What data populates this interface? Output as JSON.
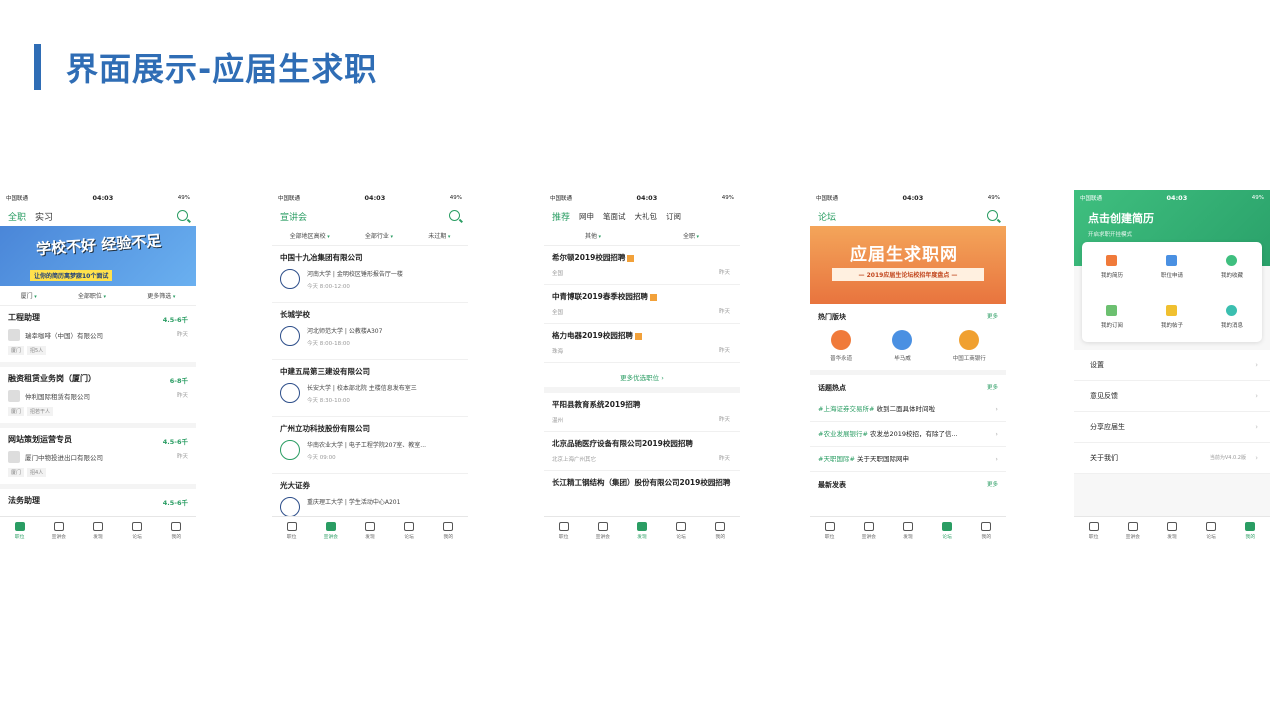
{
  "header": {
    "title": "界面展示-应届生求职"
  },
  "status": {
    "carrier": "中国联通",
    "time": "04:03",
    "battery": "49%"
  },
  "tabbar": [
    "职位",
    "宣讲会",
    "发现",
    "论坛",
    "我的"
  ],
  "p1": {
    "tabs": [
      "全职",
      "实习"
    ],
    "banner": {
      "title": "学校不好 经验不足",
      "sub": "让你的简历离梦寐10个面试"
    },
    "filters": [
      "厦门",
      "全部职位",
      "更多筛选"
    ],
    "jobs": [
      {
        "title": "工程助理",
        "salary": "4.5-6千",
        "company": "瑞幸咖啡（中国）有限公司",
        "date": "昨天",
        "tags": [
          "厦门",
          "招5人"
        ]
      },
      {
        "title": "融资租赁业务岗（厦门）",
        "salary": "6-8千",
        "company": "仲利国际租赁有限公司",
        "date": "昨天",
        "tags": [
          "厦门",
          "招若干人"
        ]
      },
      {
        "title": "网站策划运营专员",
        "salary": "4.5-6千",
        "company": "厦门中物投进出口有限公司",
        "date": "昨天",
        "tags": [
          "厦门",
          "招4人"
        ]
      },
      {
        "title": "法务助理",
        "salary": "4.5-6千",
        "company": "",
        "date": "",
        "tags": []
      }
    ]
  },
  "p2": {
    "title": "宣讲会",
    "filters": [
      "全部地区高校",
      "全部行业",
      "未过期"
    ],
    "items": [
      {
        "title": "中国十九冶集团有限公司",
        "addr": "河南大学 | 金明校区锤形报告厅一楼",
        "time": "今天 8:00-12:00"
      },
      {
        "title": "长城学校",
        "addr": "河北师范大学 | 公教楼A307",
        "time": "今天 8:00-18:00"
      },
      {
        "title": "中建五局第三建设有限公司",
        "addr": "长安大学 | 校本部北院 主楼信息发布室三",
        "time": "今天 8:30-10:00"
      },
      {
        "title": "广州立功科技股份有限公司",
        "addr": "华南农业大学 | 电子工程学院207室、教室...",
        "time": "今天 09:00"
      },
      {
        "title": "光大证券",
        "addr": "重庆理工大学 | 学生活动中心A201",
        "time": ""
      }
    ]
  },
  "p3": {
    "tabs": [
      "推荐",
      "网申",
      "笔面试",
      "大礼包",
      "订阅"
    ],
    "filters": [
      "其他",
      "全职"
    ],
    "items": [
      {
        "title": "希尔顿2019校园招聘",
        "area": "全国",
        "date": "昨天"
      },
      {
        "title": "中青博联2019春季校园招聘",
        "area": "全国",
        "date": "昨天"
      },
      {
        "title": "格力电器2019校园招聘",
        "area": "珠海",
        "date": "昨天"
      }
    ],
    "more": "更多优选职位 ›",
    "items2": [
      {
        "title": "平阳县教育系统2019招聘",
        "area": "温州",
        "date": "昨天"
      },
      {
        "title": "北京品驰医疗设备有限公司2019校园招聘",
        "area": "北京上海广州其它",
        "date": "昨天"
      },
      {
        "title": "长江精工钢结构（集团）股份有限公司2019校园招聘",
        "area": "全国",
        "date": "昨天"
      }
    ]
  },
  "p4": {
    "title": "论坛",
    "banner": {
      "title": "应届生求职网",
      "sub": "— 2019应届生论坛校招年度盘点 —"
    },
    "hot": {
      "title": "热门版块",
      "more": "更多",
      "items": [
        "普华永道",
        "毕马威",
        "中国工商银行"
      ]
    },
    "topics": {
      "title": "话题热点",
      "more": "更多",
      "items": [
        {
          "tag": "#上海证券交易所#",
          "text": "收到二面具体时间啦"
        },
        {
          "tag": "#农业发展银行#",
          "text": "农发总2019校招，有除了信..."
        },
        {
          "tag": "#天职国际#",
          "text": "关于天职国际网申"
        }
      ]
    },
    "latest": {
      "title": "最新发表",
      "more": "更多"
    }
  },
  "p5": {
    "title": "点击创建简历",
    "sub": "开启求职开挂模式",
    "grid": [
      "我的简历",
      "职位申请",
      "我的收藏",
      "我的订阅",
      "我的帖子",
      "我的消息"
    ],
    "menu": [
      "设置",
      "意见反馈",
      "分享应届生",
      "关于我们"
    ],
    "version": "当前为V4.0.2版"
  }
}
